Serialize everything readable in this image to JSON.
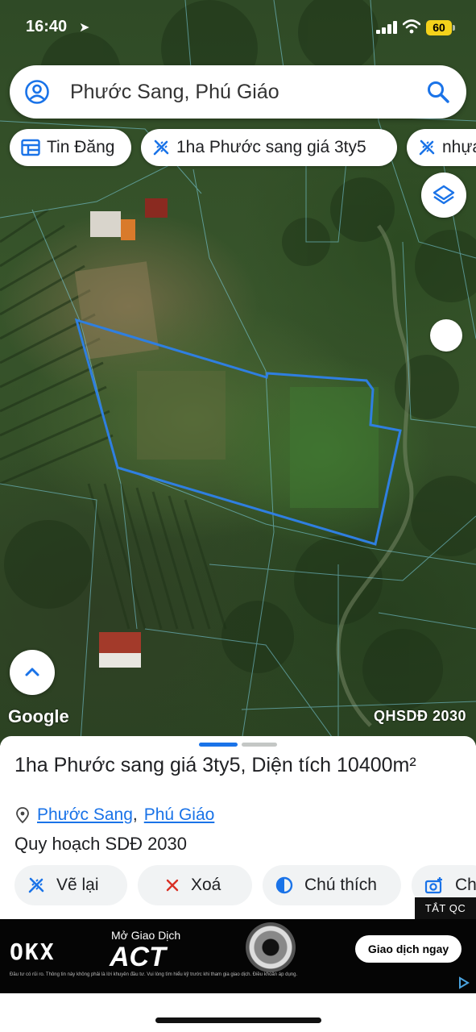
{
  "status_bar": {
    "time": "16:40",
    "battery": "60"
  },
  "search": {
    "text": "Phước Sang, Phú Giáo"
  },
  "chips": [
    {
      "label": "Tin Đăng",
      "icon": "table-icon"
    },
    {
      "label": "1ha Phước sang giá 3ty5",
      "icon": "ruler-icon"
    },
    {
      "label": "nhựa",
      "icon": "ruler-icon"
    }
  ],
  "map": {
    "attribution": "Google",
    "layer_label": "QHSDĐ 2030"
  },
  "sheet": {
    "title": "1ha Phước sang giá 3ty5, Diện tích 10400m²",
    "location_commune": "Phước Sang",
    "location_separator": ",",
    "location_district": "Phú Giáo",
    "plan": "Quy hoạch SDĐ 2030",
    "actions": [
      {
        "label": "Vẽ lại",
        "icon": "ruler-icon"
      },
      {
        "label": "Xoá",
        "icon": "close-icon"
      },
      {
        "label": "Chú thích",
        "icon": "contrast-icon"
      },
      {
        "label": "Ch",
        "icon": "add-photo-icon"
      }
    ]
  },
  "ad": {
    "close_label": "TẮT QC",
    "brand": "OKX",
    "small_text": "Mở Giao Dịch",
    "headline": "ACT",
    "cta": "Giao dịch ngay",
    "disclaimer": "Đầu tư có rủi ro. Thông tin này không phải là lời khuyên đầu tư. Vui lòng tìm hiểu kỹ trước khi tham gia giao dịch. Điều khoản áp dụng."
  },
  "colors": {
    "accent": "#1a73e8",
    "parcel_outline": "#2f7fe0",
    "battery": "#f4d21b"
  }
}
